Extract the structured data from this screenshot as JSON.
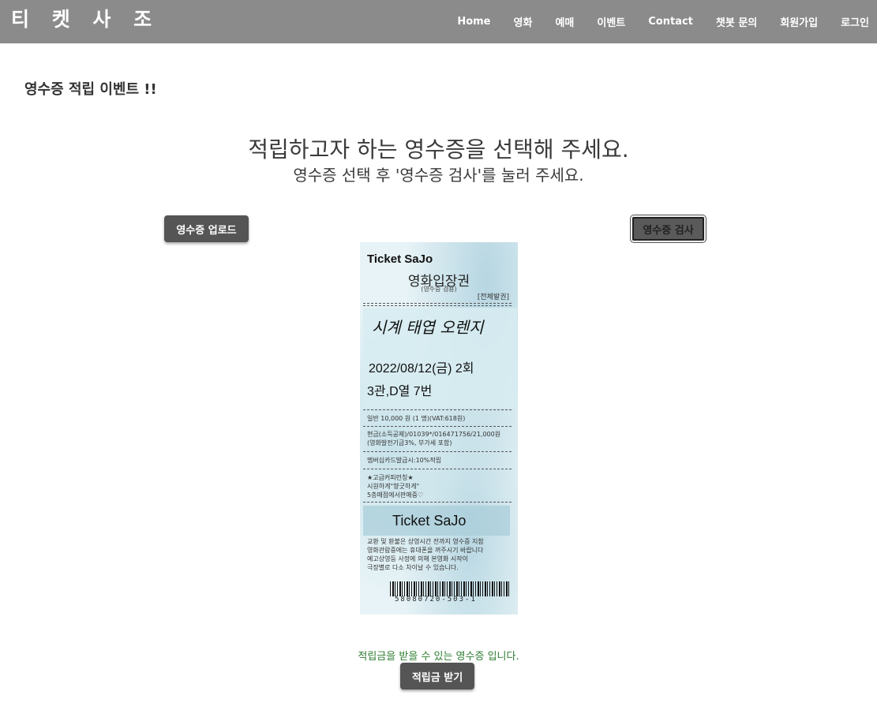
{
  "brand": "티 켓 사 조",
  "nav": {
    "items": [
      {
        "label": "Home",
        "name": "nav-home"
      },
      {
        "label": "영화",
        "name": "nav-movie"
      },
      {
        "label": "예매",
        "name": "nav-booking"
      },
      {
        "label": "이벤트",
        "name": "nav-event"
      },
      {
        "label": "Contact",
        "name": "nav-contact"
      },
      {
        "label": "챗봇 문의",
        "name": "nav-chatbot"
      },
      {
        "label": "회원가입",
        "name": "nav-signup"
      },
      {
        "label": "로그인",
        "name": "nav-login"
      }
    ]
  },
  "main": {
    "event_title": "영수증 적립 이벤트 !!",
    "headline": "적립하고자 하는 영수증을 선택해 주세요.",
    "subline": "영수증 선택 후 '영수증 검사'를 눌러 주세요.",
    "upload_label": "영수증 업로드",
    "check_label": "영수증 검사",
    "result_message": "적립금을 받을 수 있는 영수증 입니다.",
    "claim_label": "적립금 받기"
  },
  "receipt": {
    "brand": "Ticket SaJo",
    "type": "영화입장권",
    "receipt_note": "(영수증 겸용)",
    "issue": "[전체발권]",
    "movie": "시계 태엽 오렌지",
    "date": "2022/08/12(금) 2회",
    "seat": "3관,D열 7번",
    "price": "일반 10,000 원 (1 명)(VAT:618원)",
    "payment_line1": "현금(소득공제)/01039*/016471756/21,000원",
    "payment_line2": "(영화발전기금3%, 부가세 포함)",
    "membership": "멤버십카드발급시:10%적립",
    "promo_line1": "★고급커피런칭★",
    "promo_line2": "시원하게\"향긋하게\"",
    "promo_line3": "5층매점에서판매중♡",
    "brand_footer": "Ticket SaJo",
    "notice_line1": "교환 및 환불은 상영시간 전까지 영수증 지참",
    "notice_line2": "영화관람중에는 휴대폰을 꺼주시기 바랍니다",
    "notice_line3": "예고상영등 사정에 의해 본영화 시작이",
    "notice_line4": "극장별로 다소 차이날 수 있습니다.",
    "barcode_number": "58080720-503-1"
  },
  "colors": {
    "navbar": "#8c8b8c",
    "button": "#555555",
    "success_text": "#2e7d32"
  }
}
